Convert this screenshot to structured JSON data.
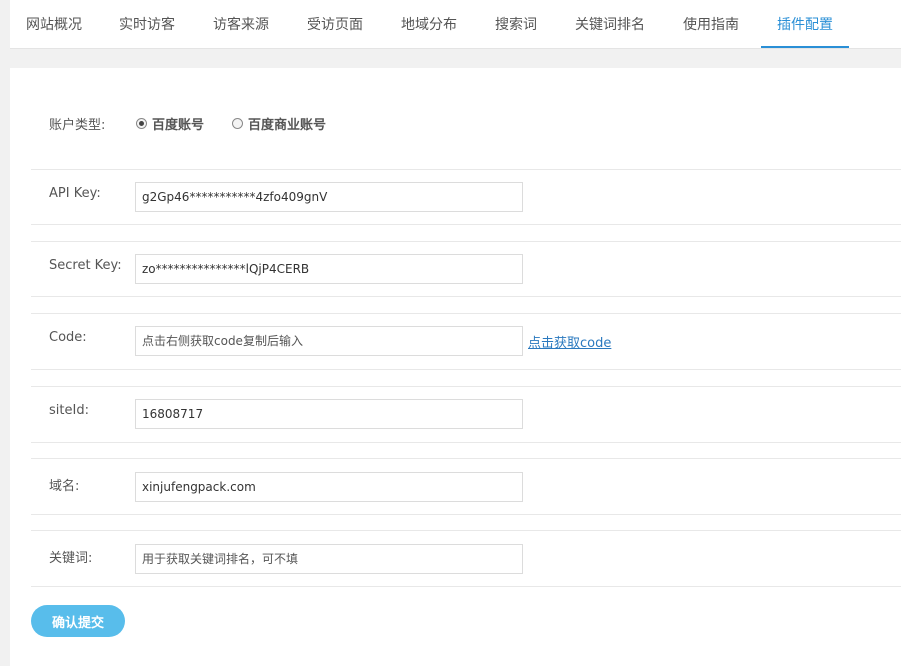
{
  "tabs": [
    {
      "label": "网站概况"
    },
    {
      "label": "实时访客"
    },
    {
      "label": "访客来源"
    },
    {
      "label": "受访页面"
    },
    {
      "label": "地域分布"
    },
    {
      "label": "搜索词"
    },
    {
      "label": "关键词排名"
    },
    {
      "label": "使用指南"
    },
    {
      "label": "插件配置",
      "active": true
    }
  ],
  "form": {
    "account_type": {
      "label": "账户类型:",
      "options": [
        {
          "label": "百度账号",
          "selected": true
        },
        {
          "label": "百度商业账号",
          "selected": false
        }
      ]
    },
    "api_key": {
      "label": "API Key:",
      "value": "g2Gp46***********4zfo409gnV"
    },
    "secret_key": {
      "label": "Secret Key:",
      "value": "zo***************lQjP4CERB"
    },
    "code": {
      "label": "Code:",
      "placeholder": "点击右侧获取code复制后输入",
      "link": "点击获取code"
    },
    "site_id": {
      "label": "siteId:",
      "value": "16808717"
    },
    "domain": {
      "label": "域名:",
      "value": "xinjufengpack.com"
    },
    "keywords": {
      "label": "关键词:",
      "placeholder": "用于获取关键词排名，可不填"
    },
    "submit_label": "确认提交"
  },
  "colors": {
    "accent": "#2a8fd6",
    "button": "#58bdeb",
    "link": "#2a79bf"
  }
}
